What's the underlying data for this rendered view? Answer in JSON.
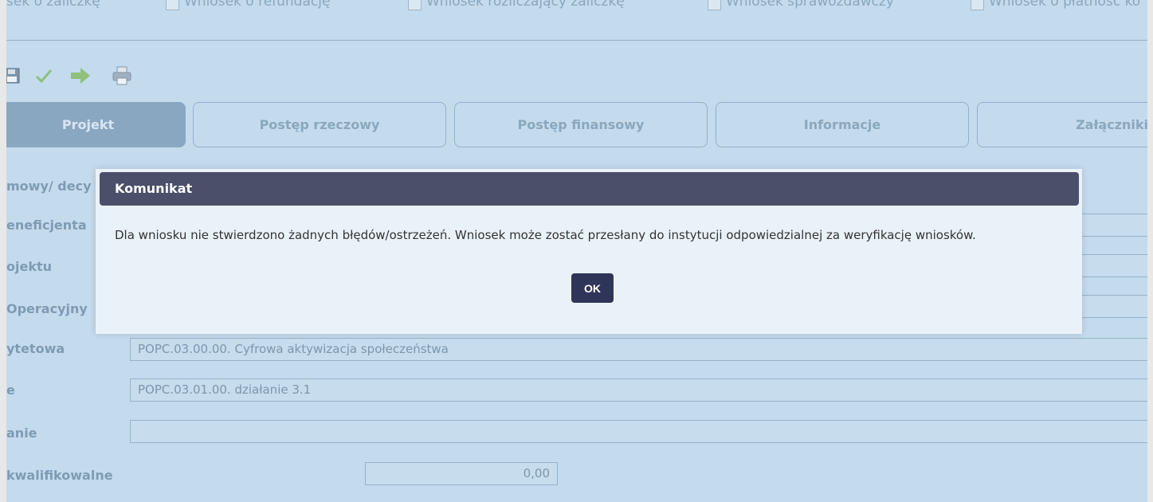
{
  "checkboxes": [
    {
      "label": "sek o zaliczkę"
    },
    {
      "label": "Wniosek o refundację"
    },
    {
      "label": "Wniosek rozliczający zaliczkę"
    },
    {
      "label": "Wniosek sprawozdawczy"
    },
    {
      "label": "Wniosek o płatność ko"
    }
  ],
  "toolbar": {
    "icons": [
      "save-icon",
      "check-icon",
      "arrow-right-icon",
      "print-icon"
    ]
  },
  "tabs": [
    {
      "label": "Projekt",
      "active": true
    },
    {
      "label": "Postęp rzeczowy",
      "active": false
    },
    {
      "label": "Postęp finansowy",
      "active": false
    },
    {
      "label": "Informacje",
      "active": false
    },
    {
      "label": "Załączniki",
      "active": false
    }
  ],
  "form": {
    "rows": [
      {
        "label": "mowy/ decy",
        "value": ""
      },
      {
        "label": "eneficjenta",
        "value": ""
      },
      {
        "label": "ojektu",
        "value": ""
      },
      {
        "label": " Operacyjny",
        "value": ""
      },
      {
        "label": "ytetowa",
        "value": "POPC.03.00.00. Cyfrowa aktywizacja społeczeństwa"
      },
      {
        "label": "e",
        "value": "POPC.03.01.00. działanie 3.1"
      },
      {
        "label": "anie",
        "value": ""
      },
      {
        "label": "kwalifikowalne",
        "value": "0,00"
      }
    ]
  },
  "dialog": {
    "title": "Komunikat",
    "message": "Dla wniosku nie stwierdzono żadnych błędów/ostrzeżeń. Wniosek może zostać przesłany do instytucji odpowiedzialnej za weryfikację wniosków.",
    "ok_label": "OK"
  },
  "colors": {
    "background": "#c4dbed",
    "dialog_header": "#4c4f6a",
    "ok_button": "#2f3558",
    "active_tab": "#8aa7c2"
  }
}
